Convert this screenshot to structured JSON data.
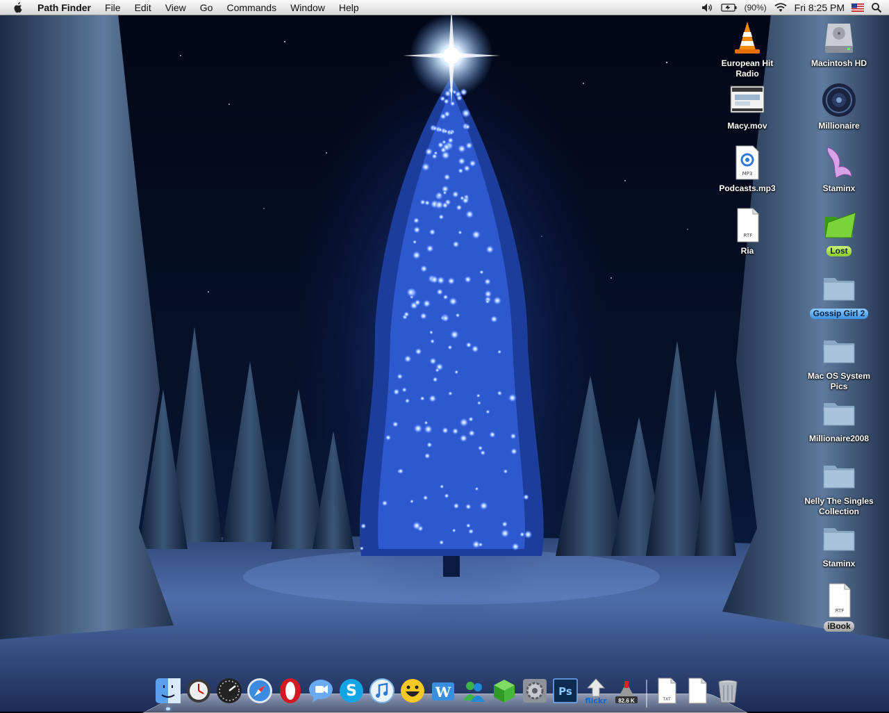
{
  "menubar": {
    "app_name": "Path Finder",
    "menus": [
      "File",
      "Edit",
      "View",
      "Go",
      "Commands",
      "Window",
      "Help"
    ],
    "battery_text": "(90%)",
    "clock": "Fri 8:25 PM",
    "status_icons": [
      "volume-icon",
      "battery-icon",
      "wifi-icon",
      "us-flag-icon",
      "spotlight-icon"
    ]
  },
  "desktop_icons": [
    {
      "label": "European Hit Radio",
      "icon": "vlc-cone-icon"
    },
    {
      "label": "Macintosh HD",
      "icon": "hard-drive-icon"
    },
    {
      "label": "Macy.mov",
      "icon": "movie-thumbnail-icon"
    },
    {
      "label": "Millionaire",
      "icon": "disk-image-icon"
    },
    {
      "label": "Podcasts.mp3",
      "icon": "mp3-file-icon",
      "badge": "MP3"
    },
    {
      "label": "Staminx",
      "icon": "staminx-app-icon"
    },
    {
      "label": "Ria",
      "icon": "rtf-file-icon",
      "badge": "RTF"
    },
    {
      "label": "Lost",
      "icon": "green-folder-icon",
      "highlight": "green"
    },
    {
      "label": "Gossip Girl 2",
      "icon": "folder-icon",
      "highlight": "blue"
    },
    {
      "label": "Mac OS System Pics",
      "icon": "folder-icon"
    },
    {
      "label": "Millionaire2008",
      "icon": "folder-icon"
    },
    {
      "label": "Nelly The Singles\nCollection",
      "icon": "folder-icon"
    },
    {
      "label": "Staminx",
      "icon": "folder-icon"
    },
    {
      "label": "iBook",
      "icon": "rtf-file-icon",
      "badge": "RTF",
      "highlight": "gray"
    }
  ],
  "dock": {
    "items": [
      "finder-icon",
      "clock-icon",
      "dashboard-icon",
      "safari-icon",
      "opera-icon",
      "ichat-icon",
      "skype-icon",
      "itunes-icon",
      "adium-icon",
      "wordpress-icon",
      "messenger-icon",
      "cube-app-icon",
      "system-preferences-icon",
      "photoshop-icon",
      "flickr-uploader-icon",
      "network-monitor-icon"
    ],
    "network_speed": "82.6 K",
    "ps_text": "Ps",
    "flickr_text": "flickr",
    "right_items": [
      "txt-document-icon",
      "document-icon",
      "trash-icon"
    ],
    "txt_badge": "TXT"
  }
}
